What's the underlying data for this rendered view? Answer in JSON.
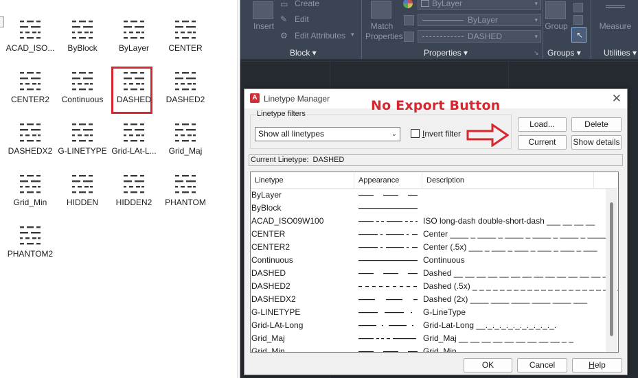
{
  "left_panel": {
    "items": [
      {
        "label": "ACAD_ISO...",
        "pattern": "dash-gap"
      },
      {
        "label": "ByBlock",
        "pattern": "solid"
      },
      {
        "label": "ByLayer",
        "pattern": "solid"
      },
      {
        "label": "CENTER",
        "pattern": "long-short"
      },
      {
        "label": "CENTER2",
        "pattern": "long-short"
      },
      {
        "label": "Continuous",
        "pattern": "solid"
      },
      {
        "label": "DASHED",
        "pattern": "dash-gap"
      },
      {
        "label": "DASHED2",
        "pattern": "dash-gap"
      },
      {
        "label": "DASHEDX2",
        "pattern": "dash-gap"
      },
      {
        "label": "G-LINETYPE",
        "pattern": "dash-gap"
      },
      {
        "label": "Grid-LAt-L...",
        "pattern": "dash-gap"
      },
      {
        "label": "Grid_Maj",
        "pattern": "dash-gap"
      },
      {
        "label": "Grid_Min",
        "pattern": "dash-gap"
      },
      {
        "label": "HIDDEN",
        "pattern": "dash-gap"
      },
      {
        "label": "HIDDEN2",
        "pattern": "dash-gap"
      },
      {
        "label": "PHANTOM",
        "pattern": "long-short"
      },
      {
        "label": "PHANTOM2",
        "pattern": "long-short"
      }
    ],
    "selected_index": 6
  },
  "ribbon": {
    "insert_label": "Insert",
    "create_label": "Create",
    "edit_label": "Edit",
    "edit_attributes_label": "Edit Attributes",
    "match_properties_label": "Match\nProperties",
    "bylayer_color": "ByLayer",
    "bylayer_lineweight": "ByLayer",
    "linetype_value": "DASHED",
    "group_label": "Group",
    "measure_label": "Measure",
    "groups": {
      "block": "Block",
      "properties": "Properties",
      "groups": "Groups",
      "utilities": "Utilities"
    }
  },
  "dialog": {
    "title": "Linetype Manager",
    "annotation": "No Export Button",
    "filters": {
      "legend": "Linetype filters",
      "selected": "Show all linetypes",
      "invert_label": "Invert filter",
      "invert_checked": false
    },
    "buttons": {
      "load": "Load...",
      "delete": "Delete",
      "current": "Current",
      "show_details": "Show details",
      "ok": "OK",
      "cancel": "Cancel",
      "help": "Help"
    },
    "current_linetype_label": "Current Linetype:",
    "current_linetype_value": "DASHED",
    "columns": {
      "linetype": "Linetype",
      "appearance": "Appearance",
      "description": "Description"
    },
    "rows": [
      {
        "name": "ByLayer",
        "pattern": "dashed",
        "description": ""
      },
      {
        "name": "ByBlock",
        "pattern": "solid",
        "description": ""
      },
      {
        "name": "ACAD_ISO09W100",
        "pattern": "long-double-short",
        "description": "ISO long-dash double-short-dash ___ __ __ __"
      },
      {
        "name": "CENTER",
        "pattern": "long-short",
        "description": "Center ____ _ ____ _ ____ _ ____ _ ____ _ ____"
      },
      {
        "name": "CENTER2",
        "pattern": "long-short",
        "description": "Center (.5x) ___ _ ___ _ ___ _ ___ _ ___ _ ___"
      },
      {
        "name": "Continuous",
        "pattern": "solid",
        "description": "Continuous"
      },
      {
        "name": "DASHED",
        "pattern": "dashed",
        "description": "Dashed __ __ __ __ __ __ __ __ __ __ __ __ __ _"
      },
      {
        "name": "DASHED2",
        "pattern": "dashed-fine",
        "description": "Dashed (.5x) _ _ _ _ _ _ _ _ _ _ _ _ _ _ _ _ _ _ _ _ _ _"
      },
      {
        "name": "DASHEDX2",
        "pattern": "dashed-long",
        "description": "Dashed (2x) ____ ____ ____ ____ ____ ___"
      },
      {
        "name": "G-LINETYPE",
        "pattern": "dash-dot",
        "description": "G-LineType"
      },
      {
        "name": "Grid-LAt-Long",
        "pattern": "long-dot",
        "description": "Grid-Lat-Long __._._._._._._._._._._."
      },
      {
        "name": "Grid_Maj",
        "pattern": "long-short-short",
        "description": "Grid_Maj __ __ __ __ __ __ __ __ __ _ _"
      },
      {
        "name": "Grid_Min",
        "pattern": "dashed",
        "description": "Grid_Min"
      }
    ]
  },
  "colors": {
    "annotation_red": "#d7262e",
    "ribbon_bg": "#3b4453",
    "drawing_bg": "#262b32"
  }
}
